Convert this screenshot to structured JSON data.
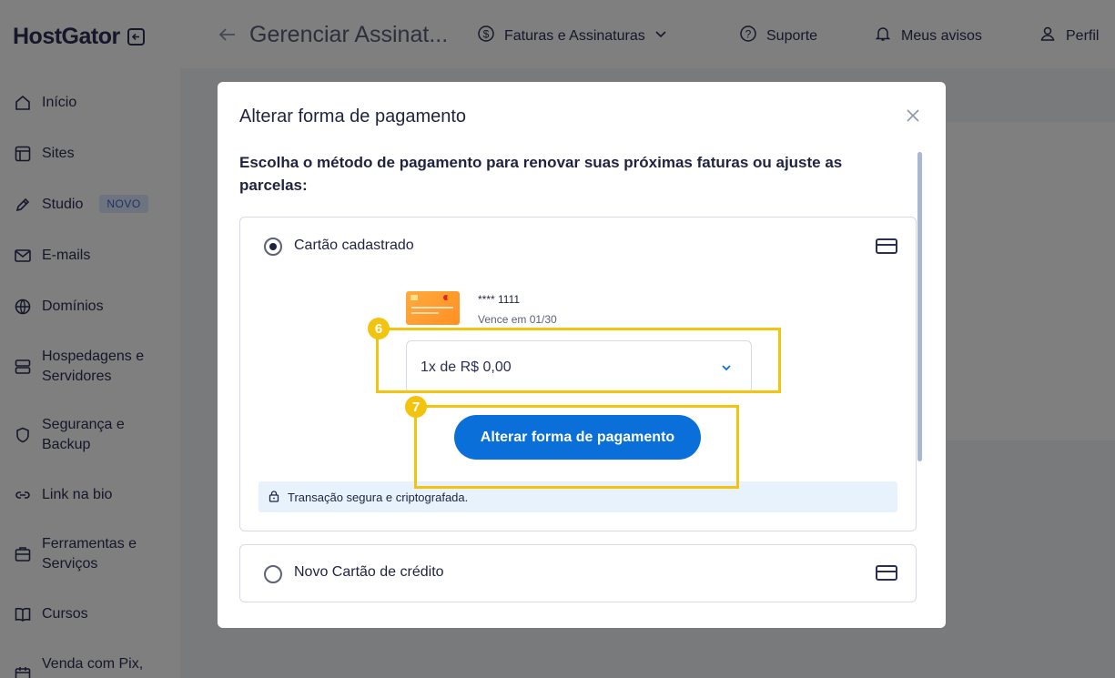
{
  "brand": {
    "logo_text": "HostGator"
  },
  "sidebar": {
    "items": [
      {
        "label": "Início",
        "icon": "home-icon"
      },
      {
        "label": "Sites",
        "icon": "layout-icon"
      },
      {
        "label": "Studio",
        "icon": "brush-icon",
        "badge": "NOVO"
      },
      {
        "label": "E-mails",
        "icon": "mail-icon"
      },
      {
        "label": "Domínios",
        "icon": "globe-icon"
      },
      {
        "label": "Hospedagens e Servidores",
        "icon": "server-icon"
      },
      {
        "label": "Segurança e Backup",
        "icon": "shield-icon"
      },
      {
        "label": "Link na bio",
        "icon": "link-icon"
      },
      {
        "label": "Ferramentas e Serviços",
        "icon": "tools-icon"
      },
      {
        "label": "Cursos",
        "icon": "book-icon"
      },
      {
        "label": "Venda com Pix,",
        "icon": "calendar-icon"
      }
    ]
  },
  "topbar": {
    "page_title": "Gerenciar Assinat...",
    "menu": [
      {
        "label": "Faturas e Assinaturas",
        "icon": "dollar-icon"
      },
      {
        "label": "Suporte",
        "icon": "help-icon"
      },
      {
        "label": "Meus avisos",
        "icon": "bell-icon"
      },
      {
        "label": "Perfil",
        "icon": "user-icon"
      }
    ]
  },
  "modal": {
    "title": "Alterar forma de pagamento",
    "intro": "Escolha o método de pagamento para renovar suas próximas faturas ou ajuste as parcelas:",
    "saved_card": {
      "label": "Cartão cadastrado",
      "selected": true,
      "number": "**** 1111",
      "expiry": "Vence em 01/30",
      "installments_value": "1x de R$ 0,00",
      "submit_label": "Alterar forma de pagamento",
      "secure_text": "Transação segura e criptografada."
    },
    "new_card": {
      "label": "Novo Cartão de crédito",
      "selected": false
    }
  },
  "steps": {
    "step6": "6",
    "step7": "7"
  },
  "colors": {
    "accent": "#0a6fd8",
    "highlight": "#f2c30f",
    "secure_bg": "#e8f2fd"
  }
}
